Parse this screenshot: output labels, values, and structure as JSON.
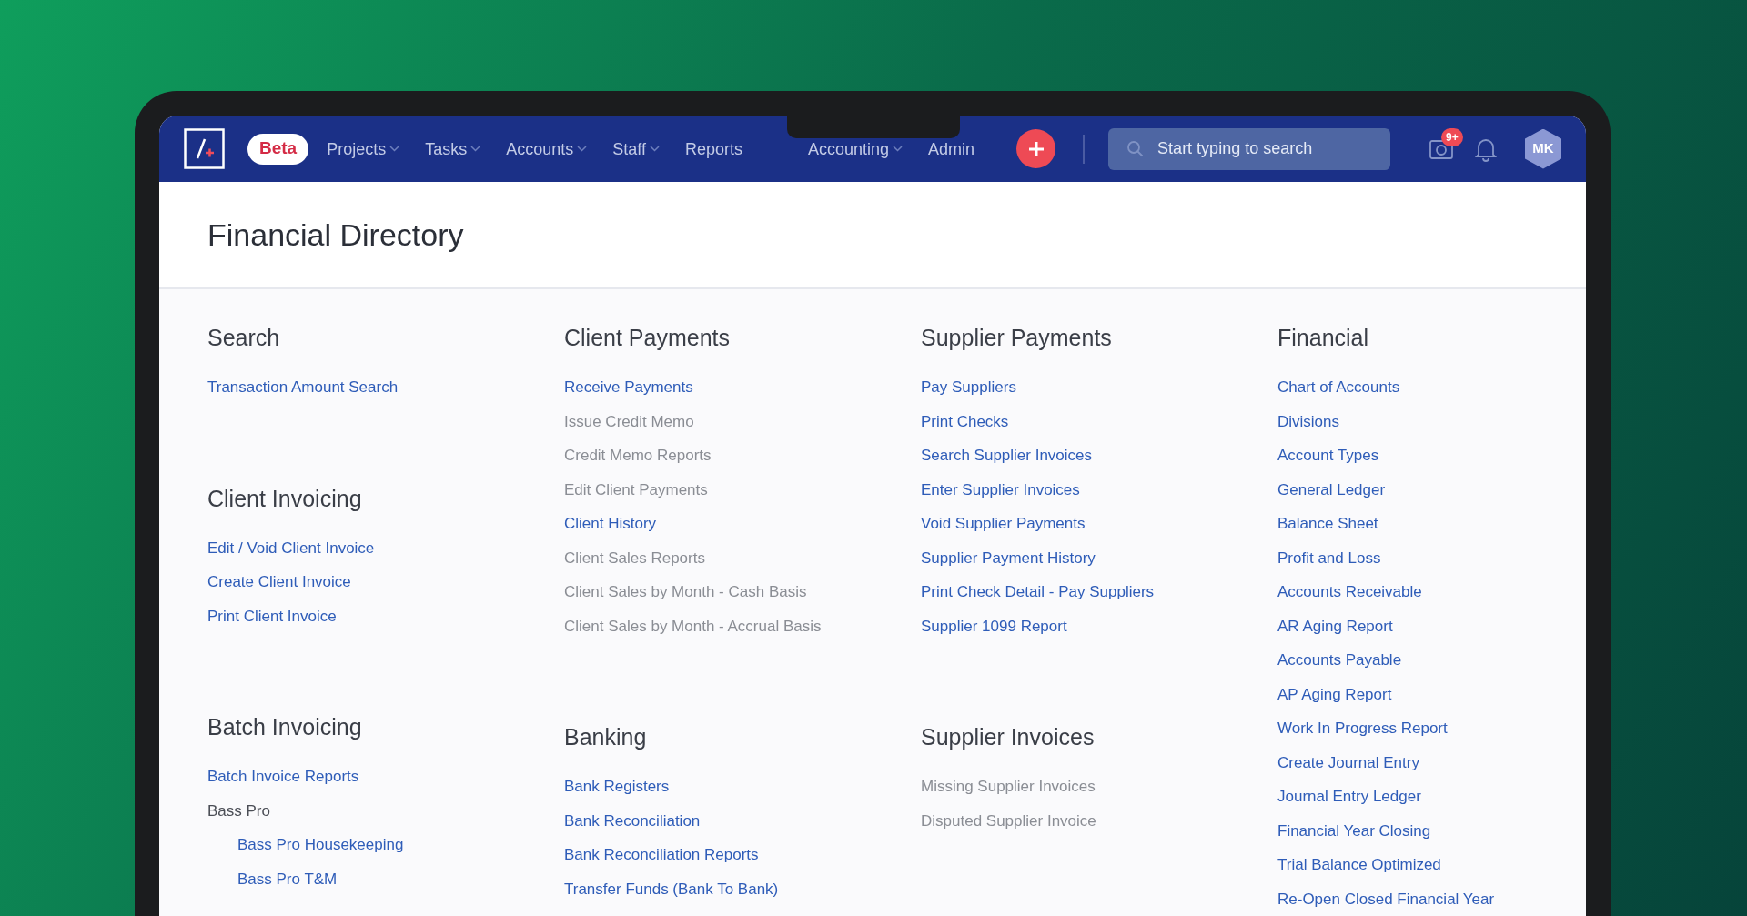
{
  "nav": {
    "badge": "Beta",
    "items": [
      {
        "label": "Projects",
        "dropdown": true
      },
      {
        "label": "Tasks",
        "dropdown": true
      },
      {
        "label": "Accounts",
        "dropdown": true
      },
      {
        "label": "Staff",
        "dropdown": true
      },
      {
        "label": "Reports",
        "dropdown": false
      },
      {
        "label": "Accounting",
        "dropdown": true
      },
      {
        "label": "Admin",
        "dropdown": false
      }
    ],
    "search": {
      "placeholder": "Start typing to search"
    },
    "notification_count": "9+",
    "avatar": "MK"
  },
  "page": {
    "title": "Financial Directory"
  },
  "columns": [
    {
      "sections": [
        {
          "title": "Search",
          "links": [
            {
              "label": "Transaction Amount Search",
              "disabled": false
            }
          ]
        },
        {
          "title": "Client Invoicing",
          "links": [
            {
              "label": "Edit / Void Client Invoice",
              "disabled": false
            },
            {
              "label": "Create Client Invoice",
              "disabled": false
            },
            {
              "label": "Print Client Invoice",
              "disabled": false
            }
          ]
        },
        {
          "title": "Batch Invoicing",
          "links": [
            {
              "label": "Batch Invoice Reports",
              "disabled": false
            },
            {
              "label": "Bass Pro",
              "kind": "group",
              "children": [
                {
                  "label": "Bass Pro Housekeeping",
                  "disabled": false
                },
                {
                  "label": "Bass Pro T&M",
                  "disabled": false
                }
              ]
            }
          ]
        }
      ]
    },
    {
      "sections": [
        {
          "title": "Client Payments",
          "links": [
            {
              "label": "Receive Payments",
              "disabled": false
            },
            {
              "label": "Issue Credit Memo",
              "disabled": true
            },
            {
              "label": "Credit Memo Reports",
              "disabled": true
            },
            {
              "label": "Edit Client Payments",
              "disabled": true
            },
            {
              "label": "Client History",
              "disabled": false
            },
            {
              "label": "Client Sales Reports",
              "disabled": true
            },
            {
              "label": "Client Sales by Month - Cash Basis",
              "disabled": true
            },
            {
              "label": "Client Sales by Month - Accrual Basis",
              "disabled": true
            }
          ]
        },
        {
          "title": "Banking",
          "links": [
            {
              "label": "Bank Registers",
              "disabled": false
            },
            {
              "label": "Bank Reconciliation",
              "disabled": false
            },
            {
              "label": "Bank Reconciliation Reports",
              "disabled": false
            },
            {
              "label": "Transfer Funds (Bank To Bank)",
              "disabled": false
            }
          ]
        }
      ]
    },
    {
      "sections": [
        {
          "title": "Supplier Payments",
          "links": [
            {
              "label": "Pay Suppliers",
              "disabled": false
            },
            {
              "label": "Print Checks",
              "disabled": false
            },
            {
              "label": "Search Supplier Invoices",
              "disabled": false
            },
            {
              "label": "Enter Supplier Invoices",
              "disabled": false
            },
            {
              "label": "Void Supplier Payments",
              "disabled": false
            },
            {
              "label": "Supplier Payment History",
              "disabled": false
            },
            {
              "label": "Print Check Detail - Pay Suppliers",
              "disabled": false
            },
            {
              "label": "Supplier 1099 Report",
              "disabled": false
            }
          ]
        },
        {
          "title": "Supplier Invoices",
          "links": [
            {
              "label": "Missing Supplier Invoices",
              "disabled": true
            },
            {
              "label": "Disputed Supplier Invoice",
              "disabled": true
            }
          ]
        }
      ]
    },
    {
      "sections": [
        {
          "title": "Financial",
          "links": [
            {
              "label": "Chart of Accounts",
              "disabled": false
            },
            {
              "label": "Divisions",
              "disabled": false
            },
            {
              "label": "Account Types",
              "disabled": false
            },
            {
              "label": "General Ledger",
              "disabled": false
            },
            {
              "label": "Balance Sheet",
              "disabled": false
            },
            {
              "label": "Profit and Loss",
              "disabled": false
            },
            {
              "label": "Accounts Receivable",
              "disabled": false
            },
            {
              "label": "AR Aging Report",
              "disabled": false
            },
            {
              "label": "Accounts Payable",
              "disabled": false
            },
            {
              "label": "AP Aging Report",
              "disabled": false
            },
            {
              "label": "Work In Progress Report",
              "disabled": false
            },
            {
              "label": "Create Journal Entry",
              "disabled": false
            },
            {
              "label": "Journal Entry Ledger",
              "disabled": false
            },
            {
              "label": "Financial Year Closing",
              "disabled": false
            },
            {
              "label": "Trial Balance Optimized",
              "disabled": false
            },
            {
              "label": "Re-Open Closed Financial Year",
              "disabled": false
            }
          ]
        }
      ]
    }
  ]
}
